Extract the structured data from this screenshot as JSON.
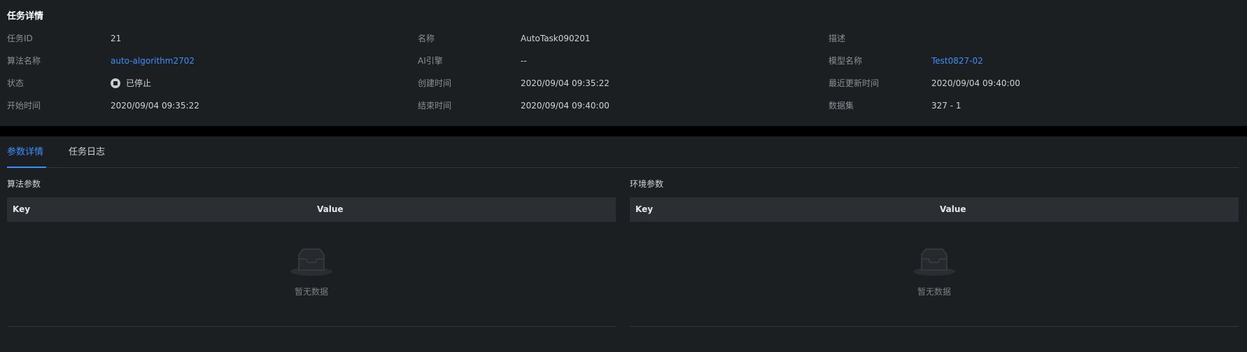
{
  "detail": {
    "title": "任务详情",
    "rows": [
      [
        {
          "label": "任务ID",
          "value": "21"
        },
        {
          "label": "名称",
          "value": "AutoTask090201"
        },
        {
          "label": "描述",
          "value": ""
        }
      ],
      [
        {
          "label": "算法名称",
          "value": "auto-algorithm2702"
        },
        {
          "label": "AI引擎",
          "value": "--"
        },
        {
          "label": "模型名称",
          "value": "Test0827-02"
        }
      ],
      [
        {
          "label": "状态",
          "value": "已停止"
        },
        {
          "label": "创建时间",
          "value": "2020/09/04 09:35:22"
        },
        {
          "label": "最近更新时间",
          "value": "2020/09/04 09:40:00"
        }
      ],
      [
        {
          "label": "开始时间",
          "value": "2020/09/04 09:35:22"
        },
        {
          "label": "结束时间",
          "value": "2020/09/04 09:40:00"
        },
        {
          "label": "数据集",
          "value": "327 - 1"
        }
      ]
    ]
  },
  "tabs": [
    {
      "label": "参数详情",
      "active": true
    },
    {
      "label": "任务日志",
      "active": false
    }
  ],
  "sections": {
    "algorithm_params": {
      "title": "算法参数",
      "columns": [
        "Key",
        "Value"
      ],
      "empty_text": "暂无数据"
    },
    "env_params": {
      "title": "环境参数",
      "columns": [
        "Key",
        "Value"
      ],
      "empty_text": "暂无数据"
    }
  },
  "colors": {
    "background": "#1c1f22",
    "link": "#3f8cff",
    "header_row": "#2b2f33",
    "separator": "#000000"
  },
  "icons": {
    "status": "stop-circle-icon",
    "empty": "empty-inbox-icon"
  }
}
